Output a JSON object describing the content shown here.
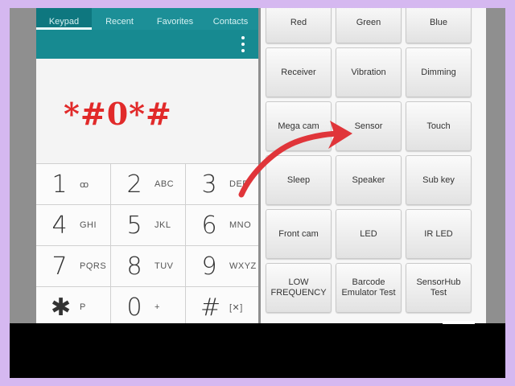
{
  "dialer": {
    "tabs": [
      {
        "label": "Keypad"
      },
      {
        "label": "Recent"
      },
      {
        "label": "Favorites"
      },
      {
        "label": "Contacts"
      }
    ],
    "dialed_code": "*#0*#",
    "keys": [
      {
        "num": "1",
        "sub": "ꝏ"
      },
      {
        "num": "2",
        "sub": "ABC"
      },
      {
        "num": "3",
        "sub": "DEF"
      },
      {
        "num": "4",
        "sub": "GHI"
      },
      {
        "num": "5",
        "sub": "JKL"
      },
      {
        "num": "6",
        "sub": "MNO"
      },
      {
        "num": "7",
        "sub": "PQRS"
      },
      {
        "num": "8",
        "sub": "TUV"
      },
      {
        "num": "9",
        "sub": "WXYZ"
      },
      {
        "num": "✱",
        "sub": "P"
      },
      {
        "num": "0",
        "sub": "+"
      },
      {
        "num": "#",
        "sub": "[✕]"
      }
    ]
  },
  "test_menu": {
    "buttons": [
      "Red",
      "Green",
      "Blue",
      "Receiver",
      "Vibration",
      "Dimming",
      "Mega cam",
      "Sensor",
      "Touch",
      "Sleep",
      "Speaker",
      "Sub key",
      "Front cam",
      "LED",
      "IR LED",
      "LOW FREQUENCY",
      "Barcode Emulator Test",
      "SensorHub Test"
    ]
  },
  "colors": {
    "tab_bar": "#1c8f97",
    "dialed_text": "#e12a2a",
    "arrow": "#e0353a",
    "page_border": "#d5b8f0"
  }
}
